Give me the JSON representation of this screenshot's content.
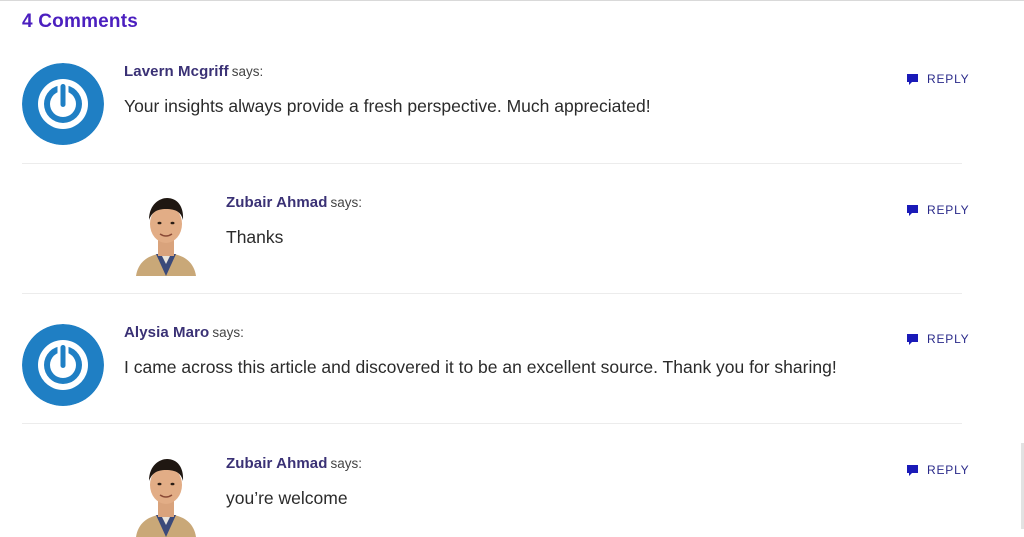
{
  "heading": "4 Comments",
  "comments": [
    {
      "author": "Lavern Mcgriff",
      "says": "says:",
      "text": "Your insights always provide a fresh perspective. Much appreciated!",
      "reply_label": "REPLY",
      "avatar": "generic-power-icon"
    },
    {
      "author": "Zubair Ahmad",
      "says": "says:",
      "text": "Thanks",
      "reply_label": "REPLY",
      "avatar": "user-photo"
    },
    {
      "author": "Alysia Maro",
      "says": "says:",
      "text": "I came across this article and discovered it to be an excellent source. Thank you for sharing!",
      "reply_label": "REPLY",
      "avatar": "generic-power-icon"
    },
    {
      "author": "Zubair Ahmad",
      "says": "says:",
      "text": "you’re welcome",
      "reply_label": "REPLY",
      "avatar": "user-photo"
    }
  ],
  "colors": {
    "heading": "#4b1fbf",
    "author": "#3a3175",
    "reply": "#2a2a8a",
    "reply_icon": "#1a1ab8",
    "avatar_blue": "#1f7fc4"
  }
}
